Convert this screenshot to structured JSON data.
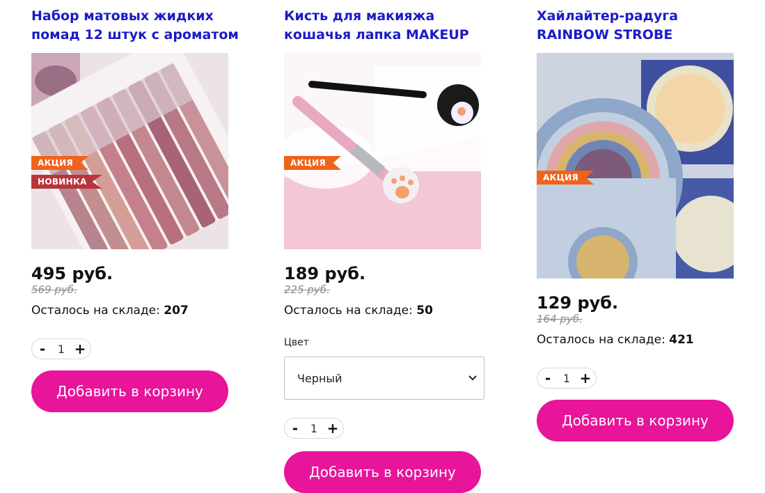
{
  "products": [
    {
      "title": "Набор матовых жидких помад 12 штук с ароматом",
      "badges": [
        "АКЦИЯ",
        "НОВИНКА"
      ],
      "price": "495 руб.",
      "old_price": "569 руб.",
      "stock_label": "Осталось на складе:",
      "stock_value": "207",
      "qty": "1",
      "minus": "-",
      "plus": "+",
      "cart_label": "Добавить в корзину"
    },
    {
      "title": "Кисть для макияжа кошачья лапка MAKEUP",
      "badges": [
        "АКЦИЯ"
      ],
      "price": "189 руб.",
      "old_price": "225 руб.",
      "stock_label": "Осталось на складе:",
      "stock_value": "50",
      "color_label": "Цвет",
      "color_value": "Черный",
      "qty": "1",
      "minus": "-",
      "plus": "+",
      "cart_label": "Добавить в корзину"
    },
    {
      "title": "Хайлайтер-радуга RAINBOW STROBE",
      "badges": [
        "АКЦИЯ"
      ],
      "price": "129 руб.",
      "old_price": "164 руб.",
      "stock_label": "Осталось на складе:",
      "stock_value": "421",
      "qty": "1",
      "minus": "-",
      "plus": "+",
      "cart_label": "Добавить в корзину"
    }
  ],
  "colors": {
    "title": "#1b1bc6",
    "button": "#e8149a",
    "badge_sale": "#f0631b",
    "badge_new": "#b8353c"
  }
}
